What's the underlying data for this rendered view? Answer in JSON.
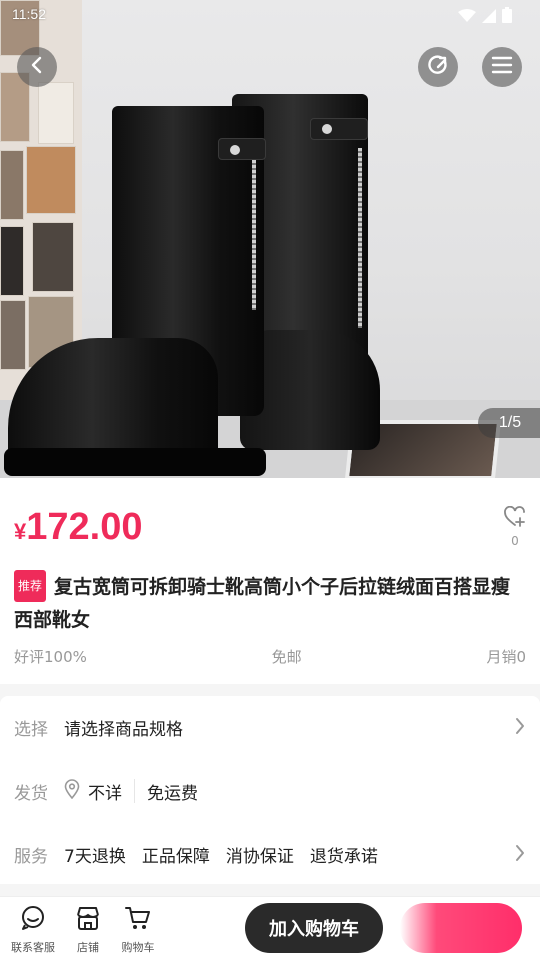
{
  "status_bar": {
    "time": "11:52"
  },
  "gallery": {
    "counter": "1/5"
  },
  "product": {
    "currency": "¥",
    "price": "172.00",
    "favorite_count": "0",
    "badge": "推荐",
    "title": "复古宽筒可拆卸骑士靴高筒小个子后拉链绒面百搭显瘦西部靴女",
    "stats": {
      "good_rating": "好评100%",
      "shipping": "免邮",
      "monthly_sales": "月销0"
    }
  },
  "spec": {
    "select_label": "选择",
    "select_value": "请选择商品规格",
    "ship_label": "发货",
    "ship_location": "不详",
    "ship_fee": "免运费",
    "service_label": "服务",
    "services": [
      "7天退换",
      "正品保障",
      "消协保证",
      "退货承诺"
    ]
  },
  "bottom_bar": {
    "tabs": [
      {
        "label": "联系客服",
        "icon": "chat-icon"
      },
      {
        "label": "店铺",
        "icon": "store-icon"
      },
      {
        "label": "购物车",
        "icon": "cart-icon"
      }
    ],
    "add_to_cart": "加入购物车"
  },
  "colors": {
    "accent": "#ef2b5a",
    "dark_button": "#2a2a2a",
    "muted_text": "#999999"
  }
}
